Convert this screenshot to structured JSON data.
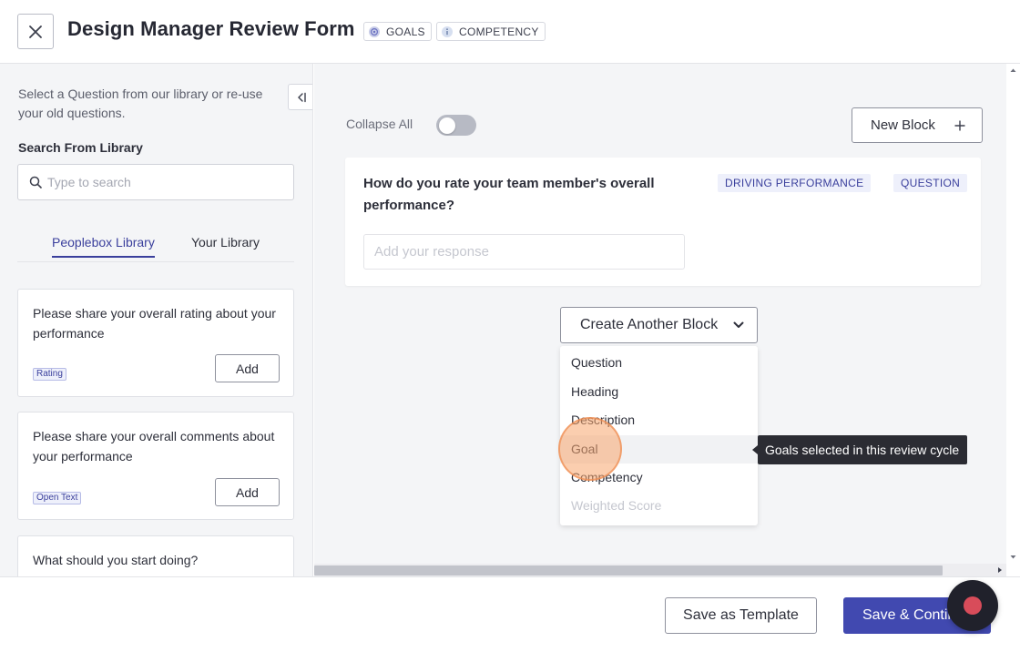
{
  "header": {
    "title": "Design Manager Review Form",
    "tags": [
      {
        "label": "GOALS",
        "icon": "target-icon"
      },
      {
        "label": "COMPETENCY",
        "icon": "info-icon"
      }
    ]
  },
  "left_panel": {
    "intro": "Select a Question from our library or re-use your old questions.",
    "search_label": "Search From Library",
    "search_placeholder": "Type to search",
    "tabs": [
      {
        "label": "Peoplebox Library",
        "active": true
      },
      {
        "label": "Your Library",
        "active": false
      }
    ],
    "cards": [
      {
        "text": "Please share your overall rating about your performance",
        "badge": "Rating",
        "action": "Add"
      },
      {
        "text": "Please share your overall comments about your performance",
        "badge": "Open Text",
        "action": "Add"
      },
      {
        "text": "What should you start doing?"
      }
    ]
  },
  "main": {
    "collapse_all_label": "Collapse All",
    "collapse_all_on": false,
    "new_block_label": "New Block",
    "question_block": {
      "title": "How do you rate your team member's overall performance?",
      "tags": [
        "DRIVING PERFORMANCE",
        "QUESTION"
      ],
      "response_placeholder": "Add your response"
    },
    "create_block_label": "Create Another Block",
    "dropdown_items": [
      {
        "label": "Question",
        "disabled": false
      },
      {
        "label": "Heading",
        "disabled": false
      },
      {
        "label": "Description",
        "disabled": false
      },
      {
        "label": "Goal",
        "disabled": false,
        "hovered": true
      },
      {
        "label": "Competency",
        "disabled": false
      },
      {
        "label": "Weighted Score",
        "disabled": true
      }
    ],
    "tooltip": "Goals selected in this review cycle"
  },
  "footer": {
    "save_template_label": "Save as Template",
    "save_continue_label": "Save & Continue"
  },
  "colors": {
    "primary": "#4149b0",
    "accent_text": "#3a3f9c",
    "panel_bg": "#f4f5f7",
    "click_highlight": "#f8a66e"
  }
}
